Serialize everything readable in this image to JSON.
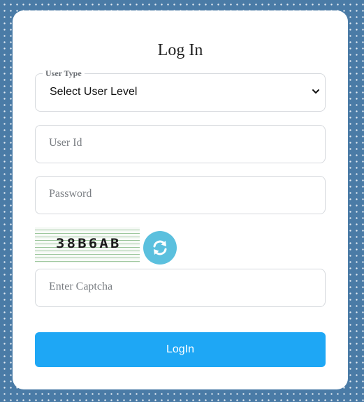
{
  "login_form": {
    "title": "Log In",
    "user_type": {
      "legend": "User Type",
      "selected": "Select User Level"
    },
    "user_id": {
      "placeholder": "User Id"
    },
    "password": {
      "placeholder": "Password"
    },
    "captcha": {
      "code": "38B6AB",
      "refresh_icon": "refresh-icon"
    },
    "captcha_input": {
      "placeholder": "Enter Captcha"
    },
    "submit_label": "LogIn"
  },
  "colors": {
    "background": "#4a7ba6",
    "card": "#ffffff",
    "button": "#1ea7f5",
    "refresh": "#5bc0de"
  }
}
